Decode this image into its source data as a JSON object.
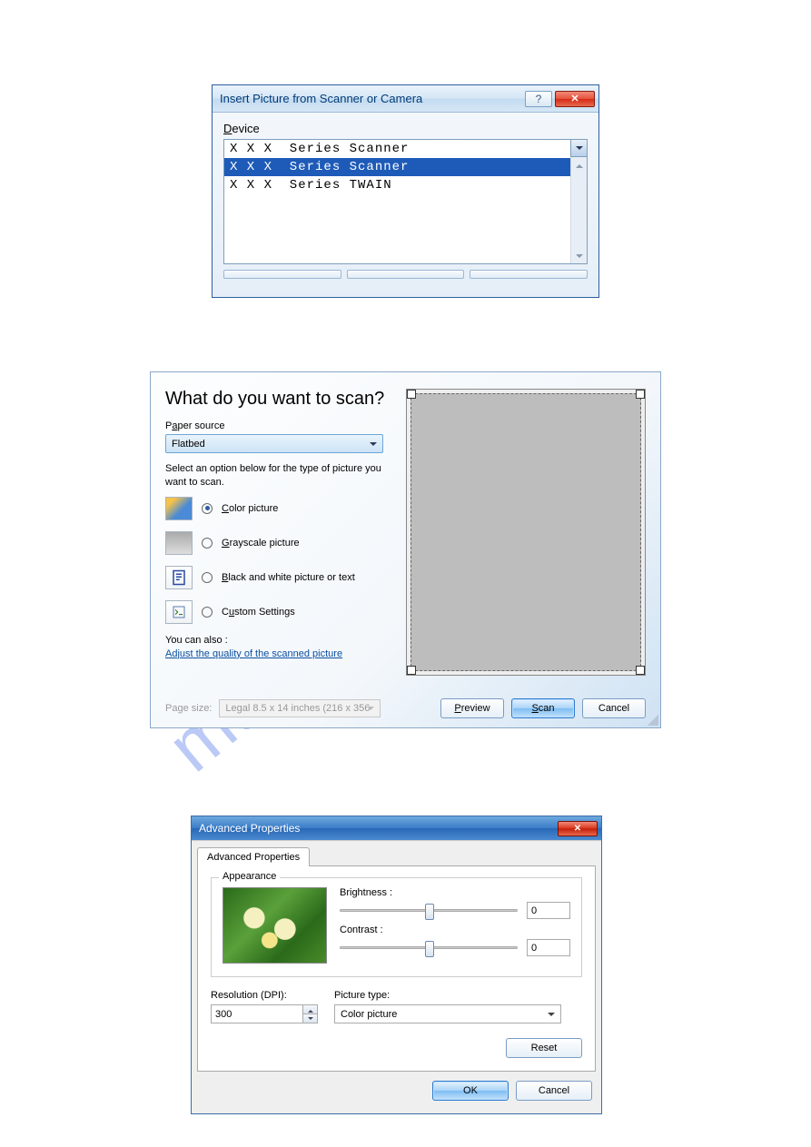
{
  "watermark": "manualshive.com",
  "dialog1": {
    "title": "Insert Picture from Scanner or Camera",
    "help_icon": "?",
    "close_icon": "✕",
    "device_label": "Device",
    "items": [
      "X X X  Series Scanner",
      "X X X  Series Scanner",
      "X X X  Series TWAIN"
    ],
    "selected_index": 1
  },
  "dialog2": {
    "title": "What do you want to scan?",
    "paper_source_label": "Paper source",
    "paper_source_value": "Flatbed",
    "instruction": "Select an option below for the type of picture you want to scan.",
    "options": {
      "color": "Color picture",
      "grayscale": "Grayscale picture",
      "bw": "Black and white picture or text",
      "custom": "Custom Settings"
    },
    "selected_option": "color",
    "also_label": "You can also :",
    "adjust_link": "Adjust the quality of the scanned picture",
    "page_size_label": "Page size:",
    "page_size_value": "Legal 8.5 x 14 inches (216 x 356",
    "buttons": {
      "preview": "Preview",
      "scan": "Scan",
      "cancel": "Cancel"
    }
  },
  "dialog3": {
    "title": "Advanced Properties",
    "tab": "Advanced Properties",
    "appearance_legend": "Appearance",
    "brightness_label": "Brightness :",
    "brightness_value": "0",
    "contrast_label": "Contrast :",
    "contrast_value": "0",
    "resolution_label": "Resolution (DPI):",
    "resolution_value": "300",
    "picture_type_label": "Picture type:",
    "picture_type_value": "Color picture",
    "reset": "Reset",
    "ok": "OK",
    "cancel": "Cancel",
    "close_icon": "✕"
  }
}
